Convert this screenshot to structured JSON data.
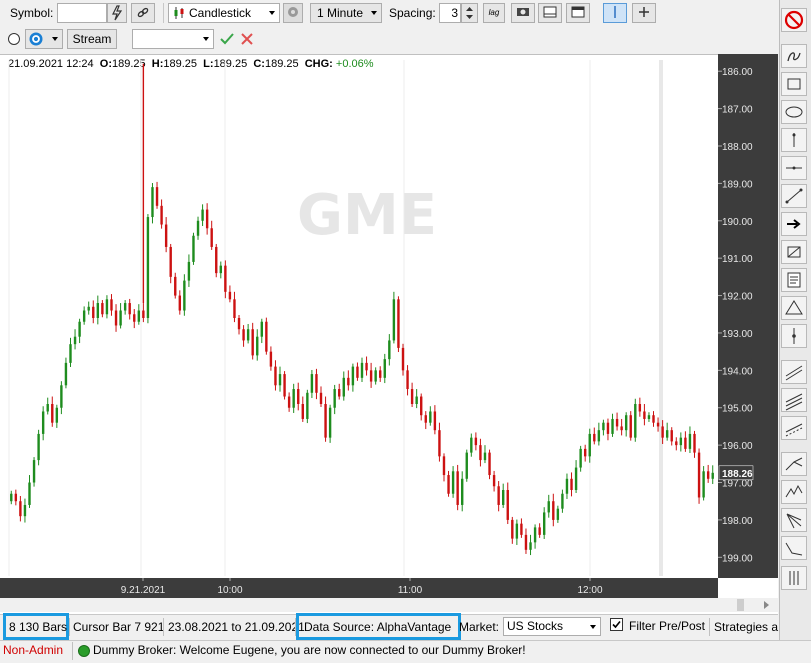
{
  "toolbar": {
    "symbol_label": "Symbol:",
    "symbol_value": "",
    "chart_type": "Candlestick",
    "interval": "1 Minute",
    "spacing_label": "Spacing:",
    "spacing_value": "3",
    "log_label": "lag",
    "stream_label": "Stream",
    "combo_value": ""
  },
  "info_bar": {
    "datetime": "21.09.2021 12:24",
    "o_label": "O:",
    "o_value": "189.25",
    "h_label": "H:",
    "h_value": "189.25",
    "l_label": "L:",
    "l_value": "189.25",
    "c_label": "C:",
    "c_value": "189.25",
    "chg_label": "CHG:",
    "chg_value": "+0.06%"
  },
  "watermark": "GME",
  "price_axis": {
    "ticks": [
      "199.00",
      "198.00",
      "197.00",
      "196.00",
      "195.00",
      "194.00",
      "193.00",
      "192.00",
      "191.00",
      "190.00",
      "189.00",
      "188.00",
      "187.00",
      "186.00"
    ],
    "current_price": "188.26"
  },
  "time_axis": {
    "ticks": [
      "9.21.2021",
      "10:00",
      "11:00",
      "12:00"
    ]
  },
  "status": {
    "bars": "8 130 Bars",
    "cursor_bar": "Cursor Bar 7 921",
    "range": "23.08.2021 to 21.09.2021",
    "data_source": "Data Source: AlphaVantage",
    "market_label": "Market:",
    "market_value": "US Stocks",
    "filter_label": "Filter Pre/Post",
    "strategies": "Strategies a"
  },
  "footer": {
    "user_role": "Non-Admin",
    "message": "Dummy Broker: Welcome Eugene, you are now connected to our Dummy Broker!"
  },
  "colors": {
    "up": "#1e8c1e",
    "down": "#cc1111",
    "axis_bg": "#3c3c3c",
    "highlight": "#1a9ae0",
    "role": "#d00000"
  },
  "chart_data": {
    "type": "candlestick",
    "title": "GME",
    "x_ticks": [
      "9.21.2021",
      "10:00",
      "11:00",
      "12:00"
    ],
    "ylim": [
      185.5,
      199.3
    ],
    "y_ticks": [
      186,
      187,
      188,
      189,
      190,
      191,
      192,
      193,
      194,
      195,
      196,
      197,
      198,
      199
    ],
    "last_price": 188.26,
    "last_bar": {
      "time": "21.09.2021 12:24",
      "open": 189.25,
      "high": 189.25,
      "low": 189.25,
      "close": 189.25,
      "change_pct": "+0.06%"
    },
    "series": [
      {
        "closes": [
          187.7,
          187.5,
          187.1,
          187.4,
          188.0,
          188.6,
          189.3,
          189.9,
          190.1,
          189.6,
          190.0,
          190.6,
          191.2,
          191.7,
          191.9,
          192.3,
          192.6,
          192.7,
          192.4,
          192.8,
          192.5,
          192.9,
          192.6,
          192.2,
          192.6,
          192.8,
          192.5,
          192.3,
          192.6,
          192.4,
          195.1,
          195.9,
          195.4,
          194.9,
          194.3,
          193.5,
          193.0,
          192.6,
          193.4,
          193.9,
          194.6,
          195.0,
          195.3,
          194.8,
          194.3,
          193.6,
          193.8,
          193.1,
          192.9,
          192.4,
          192.1,
          191.8,
          192.1,
          191.4,
          191.9,
          192.3,
          191.5,
          191.1,
          190.6,
          190.9,
          190.3,
          190.0,
          190.5,
          190.1,
          189.7,
          190.4,
          190.9,
          190.4,
          190.1,
          189.2,
          190.0,
          190.5,
          190.3,
          190.8,
          190.6,
          191.1,
          190.8,
          191.2,
          191.0,
          190.7,
          191.0,
          190.8,
          191.3,
          191.8,
          192.9,
          191.6,
          191.0,
          190.5,
          190.1,
          190.3,
          189.8,
          189.6,
          189.9,
          189.4,
          188.7,
          188.2,
          187.7,
          188.3,
          187.4,
          188.1,
          188.8,
          189.2,
          189.0,
          188.6,
          188.8,
          188.2,
          187.9,
          187.4,
          187.8,
          187.0,
          186.5,
          186.9,
          186.6,
          186.2,
          186.4,
          186.8,
          186.6,
          187.2,
          187.5,
          187.0,
          187.3,
          187.7,
          188.1,
          187.8,
          188.4,
          188.9,
          188.7,
          189.3,
          189.1,
          189.4,
          189.6,
          189.3,
          189.7,
          189.5,
          189.4,
          189.8,
          189.2,
          190.1,
          189.9,
          189.7,
          189.8,
          189.6,
          189.5,
          189.2,
          189.4,
          189.1,
          189.0,
          189.2,
          188.9,
          189.3,
          188.8,
          187.6,
          188.3,
          188.1,
          188.26
        ]
      }
    ]
  }
}
